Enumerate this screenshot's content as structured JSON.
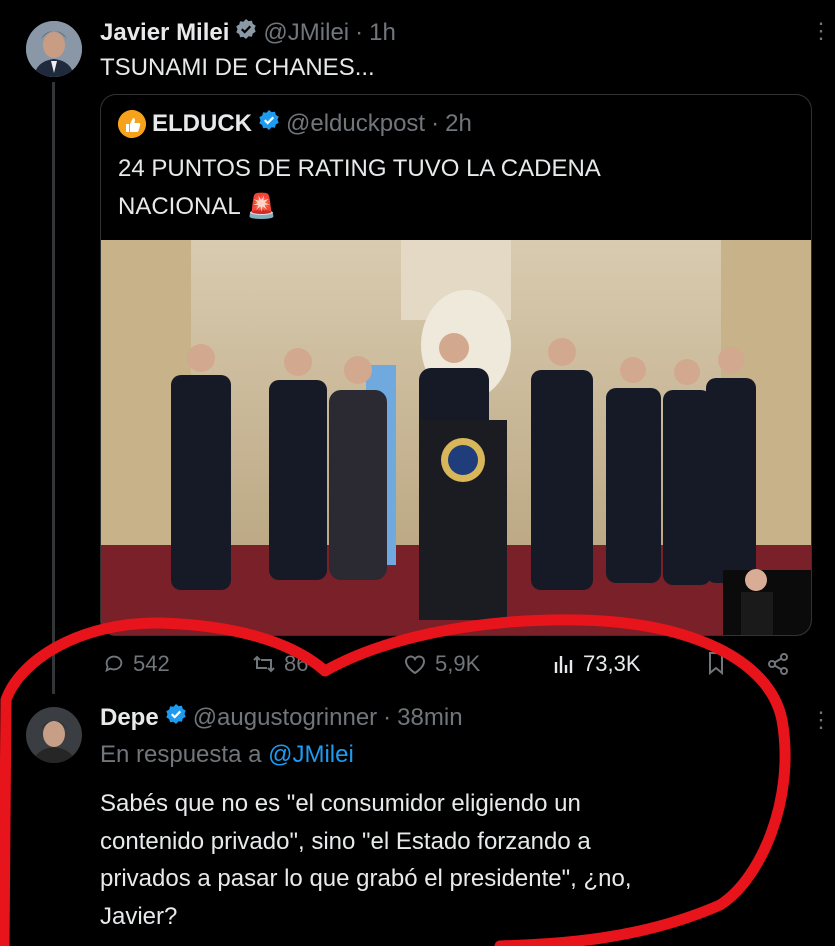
{
  "tweet": {
    "author_name": "Javier Milei",
    "handle": "@JMilei",
    "time": "1h",
    "text": "TSUNAMI DE CHANES...",
    "quote": {
      "author_name": "ELDUCK",
      "handle": "@elduckpost",
      "time": "2h",
      "text_line1": "24 PUNTOS DE RATING TUVO LA CADENA",
      "text_line2": "NACIONAL",
      "emoji": "🚨"
    },
    "actions": {
      "replies": "542",
      "retweets": "86",
      "likes": "5,9K",
      "views": "73,3K"
    }
  },
  "reply": {
    "author_name": "Depe",
    "handle": "@augustogrinner",
    "time": "38min",
    "reply_to_label": "En respuesta a",
    "reply_to_handle": "@JMilei",
    "text_line1": "Sabés que no es \"el consumidor eligiendo un",
    "text_line2": "contenido privado\", sino \"el Estado forzando a",
    "text_line3": "privados a pasar lo que grabó el presidente\", ¿no,",
    "text_line4": "Javier?"
  },
  "colors": {
    "verified": "#1d9bf0",
    "link": "#1d9bf0",
    "annotation": "#e8141b"
  }
}
